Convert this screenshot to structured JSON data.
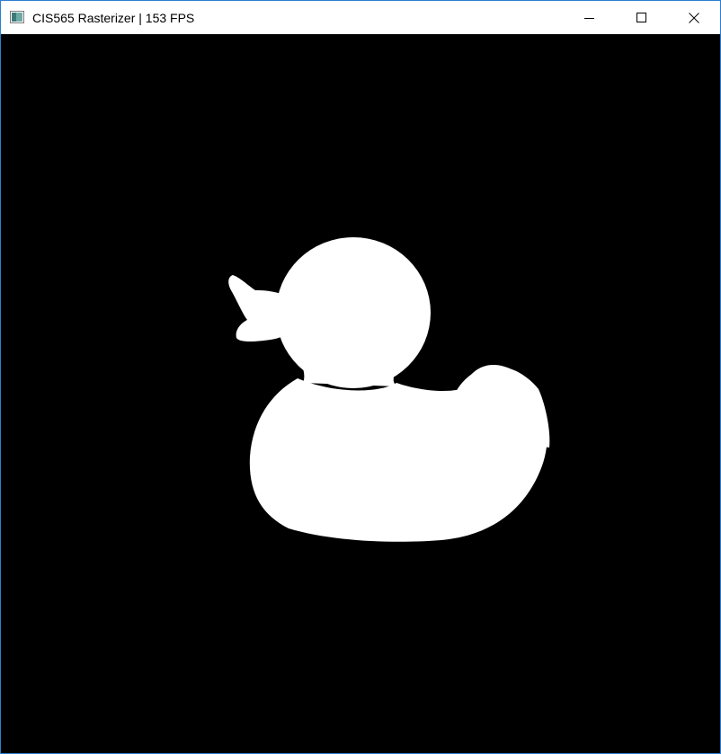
{
  "window": {
    "title": "CIS565 Rasterizer | 153 FPS",
    "app_icon": "application-window-icon",
    "controls": {
      "minimize_icon": "minimize-icon",
      "maximize_icon": "maximize-icon",
      "close_icon": "close-icon"
    },
    "accent_color": "#2b7fd2"
  },
  "viewport": {
    "background_color": "#000000",
    "render": {
      "object": "rubber-duck-silhouette",
      "fill_color": "#ffffff"
    }
  }
}
